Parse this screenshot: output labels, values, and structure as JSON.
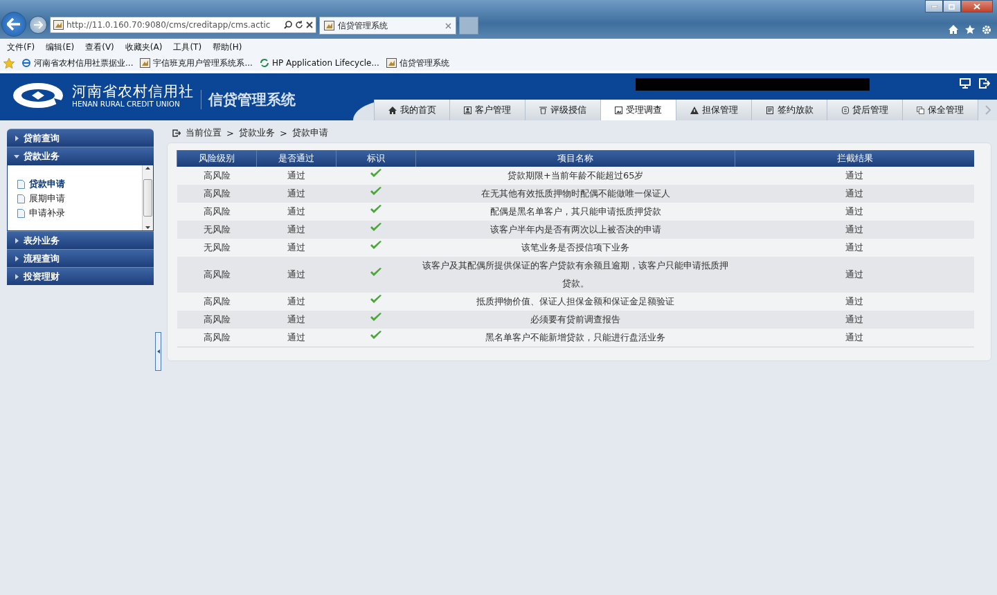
{
  "browser": {
    "url": "http://11.0.160.70:9080/cms/creditapp/cms.actic",
    "tab_title": "信贷管理系统",
    "menu": [
      "文件(F)",
      "编辑(E)",
      "查看(V)",
      "收藏夹(A)",
      "工具(T)",
      "帮助(H)"
    ],
    "favorites": [
      {
        "label": "河南省农村信用社票据业...",
        "kind": "ie"
      },
      {
        "label": "宇信班克用户管理系统系...",
        "kind": "page"
      },
      {
        "label": "HP Application Lifecycle...",
        "kind": "hp"
      },
      {
        "label": "信贷管理系统",
        "kind": "page"
      }
    ]
  },
  "header": {
    "org_name": "河南省农村信用社",
    "org_name_en": "HENAN RURAL CREDIT UNION",
    "system_title": "信贷管理系统",
    "nav": [
      {
        "label": "我的首页",
        "kind": "home",
        "selected": false
      },
      {
        "label": "客户管理",
        "kind": "user",
        "selected": false
      },
      {
        "label": "评级授信",
        "kind": "bin",
        "selected": false
      },
      {
        "label": "受理调查",
        "kind": "doc",
        "selected": true
      },
      {
        "label": "担保管理",
        "kind": "warn",
        "selected": false
      },
      {
        "label": "签约放款",
        "kind": "sign",
        "selected": false
      },
      {
        "label": "贷后管理",
        "kind": "list",
        "selected": false
      },
      {
        "label": "保全管理",
        "kind": "copy",
        "selected": false
      }
    ]
  },
  "sidebar": [
    {
      "label": "贷前查询",
      "expanded": false
    },
    {
      "label": "贷款业务",
      "expanded": true,
      "items": [
        {
          "label": "贷款申请",
          "selected": true
        },
        {
          "label": "展期申请",
          "selected": false
        },
        {
          "label": "申请补录",
          "selected": false
        }
      ]
    },
    {
      "label": "表外业务",
      "expanded": false
    },
    {
      "label": "流程查询",
      "expanded": false
    },
    {
      "label": "投资理财",
      "expanded": false
    }
  ],
  "breadcrumb": {
    "items": [
      "当前位置",
      "贷款业务",
      "贷款申请"
    ],
    "separator": ">"
  },
  "table": {
    "columns": [
      "风险级别",
      "是否通过",
      "标识",
      "项目名称",
      "拦截结果"
    ],
    "rows": [
      {
        "risk": "高风险",
        "passed": "通过",
        "ok": true,
        "name": "贷款期限+当前年龄不能超过65岁",
        "result": "通过"
      },
      {
        "risk": "高风险",
        "passed": "通过",
        "ok": true,
        "name": "在无其他有效抵质押物时配偶不能做唯一保证人",
        "result": "通过"
      },
      {
        "risk": "高风险",
        "passed": "通过",
        "ok": true,
        "name": "配偶是黑名单客户，其只能申请抵质押贷款",
        "result": "通过"
      },
      {
        "risk": "无风险",
        "passed": "通过",
        "ok": true,
        "name": "该客户半年内是否有两次以上被否决的申请",
        "result": "通过"
      },
      {
        "risk": "无风险",
        "passed": "通过",
        "ok": true,
        "name": "该笔业务是否授信项下业务",
        "result": "通过"
      },
      {
        "risk": "高风险",
        "passed": "通过",
        "ok": true,
        "name": "该客户及其配偶所提供保证的客户贷款有余额且逾期，该客户只能申请抵质押贷款。",
        "result": "通过"
      },
      {
        "risk": "高风险",
        "passed": "通过",
        "ok": true,
        "name": "抵质押物价值、保证人担保金额和保证金足额验证",
        "result": "通过"
      },
      {
        "risk": "高风险",
        "passed": "通过",
        "ok": true,
        "name": "必须要有贷前调查报告",
        "result": "通过"
      },
      {
        "risk": "高风险",
        "passed": "通过",
        "ok": true,
        "name": "黑名单客户不能新增贷款，只能进行盘活业务",
        "result": "通过"
      }
    ]
  }
}
